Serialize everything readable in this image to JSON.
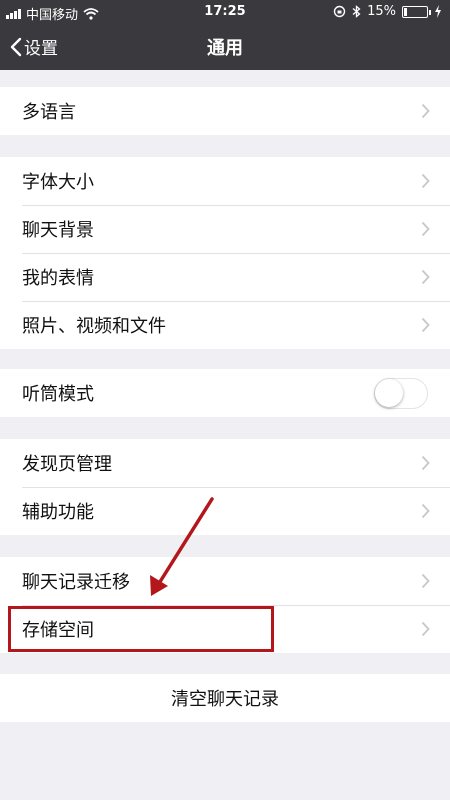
{
  "status_bar": {
    "carrier": "中国移动",
    "time": "17:25",
    "battery": "15%",
    "battery_level": 0.15
  },
  "nav": {
    "back_label": "设置",
    "title": "通用"
  },
  "groups": [
    {
      "items": [
        {
          "label": "多语言",
          "accessory": "chevron"
        }
      ]
    },
    {
      "items": [
        {
          "label": "字体大小",
          "accessory": "chevron"
        },
        {
          "label": "聊天背景",
          "accessory": "chevron"
        },
        {
          "label": "我的表情",
          "accessory": "chevron"
        },
        {
          "label": "照片、视频和文件",
          "accessory": "chevron"
        }
      ]
    },
    {
      "items": [
        {
          "label": "听筒模式",
          "accessory": "toggle",
          "toggle_on": false
        }
      ]
    },
    {
      "items": [
        {
          "label": "发现页管理",
          "accessory": "chevron"
        },
        {
          "label": "辅助功能",
          "accessory": "chevron"
        }
      ]
    },
    {
      "items": [
        {
          "label": "聊天记录迁移",
          "accessory": "chevron"
        },
        {
          "label": "存储空间",
          "accessory": "chevron",
          "highlighted": true
        }
      ]
    }
  ],
  "clear_chat_label": "清空聊天记录",
  "colors": {
    "nav_bg": "#3a3a3e",
    "page_bg": "#efeff4",
    "annotation": "#b3171c",
    "chevron": "#c7c7cc"
  }
}
